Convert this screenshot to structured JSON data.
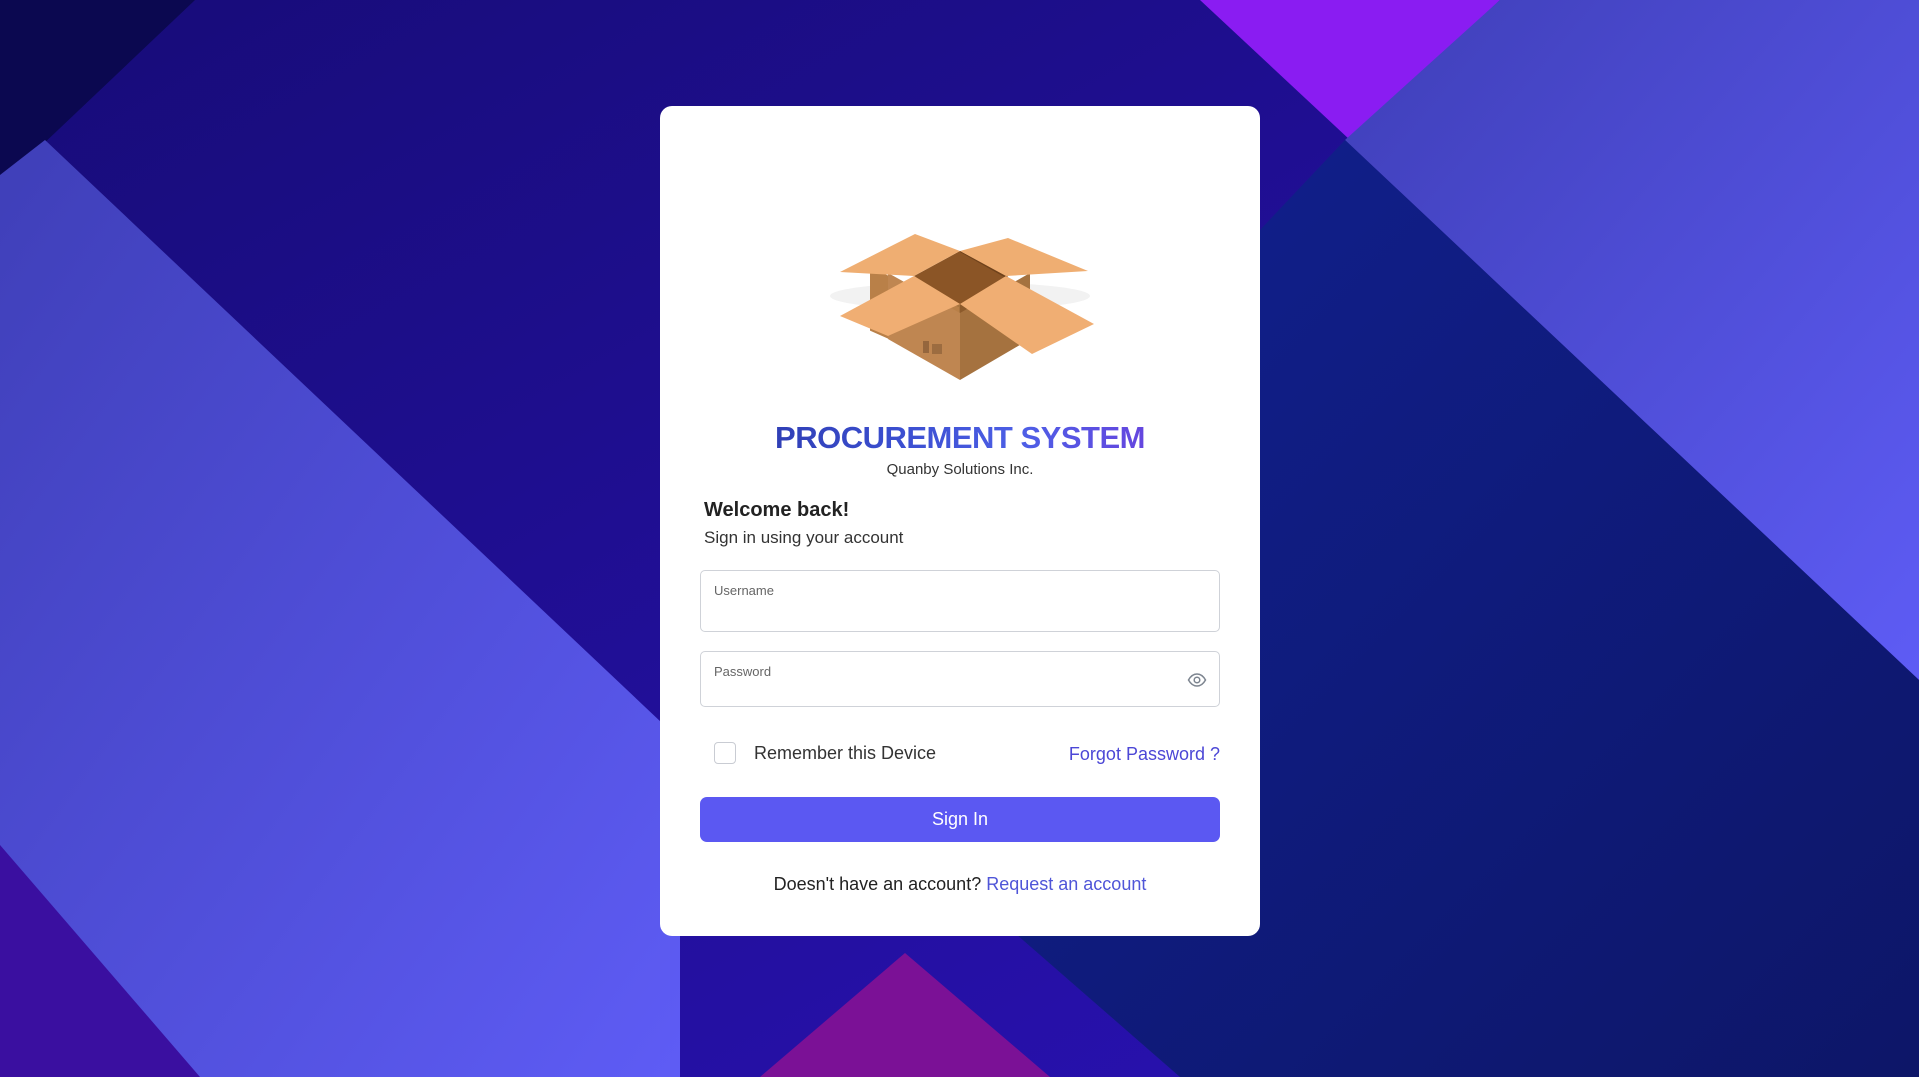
{
  "app": {
    "title": "PROCUREMENT SYSTEM",
    "company": "Quanby Solutions Inc."
  },
  "login": {
    "welcome": "Welcome back!",
    "subtitle": "Sign in using your account",
    "username_label": "Username",
    "password_label": "Password",
    "remember_label": "Remember this Device",
    "forgot_label": "Forgot Password ?",
    "signin_label": "Sign In",
    "footer_text": "Doesn't have an account?",
    "request_label": "Request an account"
  },
  "icons": {
    "logo": "open-box-icon",
    "password_toggle": "eye-icon"
  },
  "colors": {
    "primary": "#5b58f2",
    "link": "#4c47d6",
    "background": "#1a0f8a"
  }
}
